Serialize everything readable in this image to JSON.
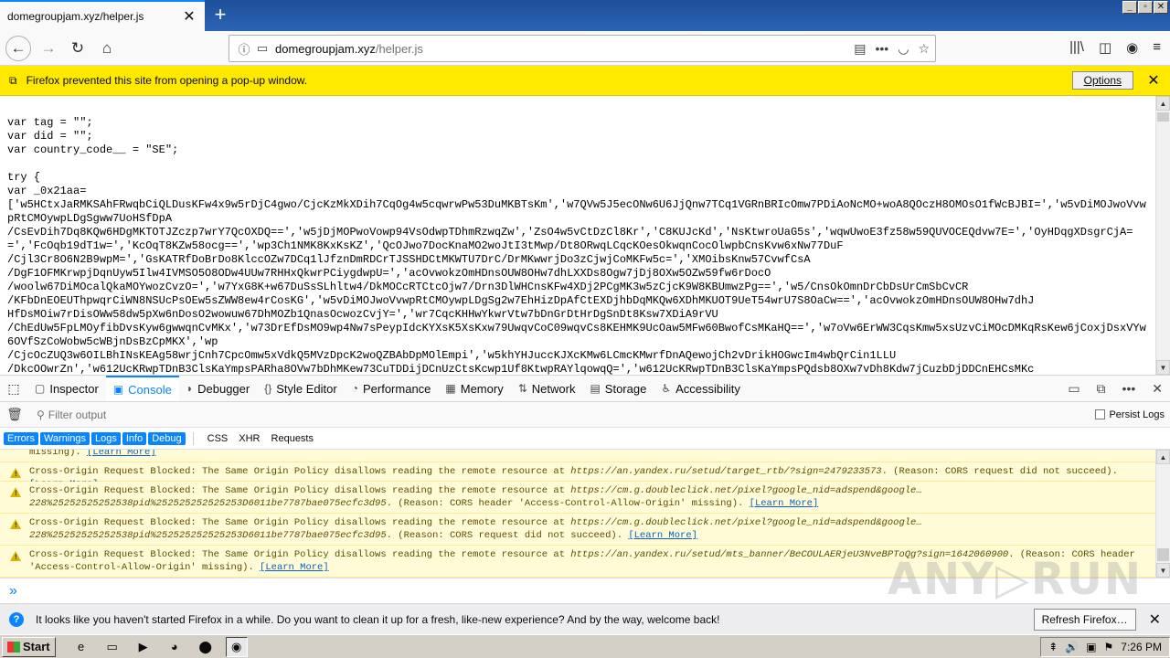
{
  "tab": {
    "title": "domegroupjam.xyz/helper.js",
    "close": "✕",
    "new_tab": "+"
  },
  "window_controls": [
    "_",
    "▫",
    "✕"
  ],
  "nav": {
    "back": "←",
    "forward": "→",
    "reload": "↻",
    "home": "⌂",
    "url_host": "domegroupjam.xyz",
    "url_path": "/helper.js",
    "info_icon": "ⓘ",
    "page_icon": "▭",
    "reader": "▤",
    "more": "•••",
    "pocket": "◡",
    "bookmark": "☆",
    "library": "|||\\",
    "sidebar": "◫",
    "account": "◉",
    "menu": "≡"
  },
  "popup_bar": {
    "icon": "⧉",
    "message": "Firefox prevented this site from opening a pop-up window.",
    "options": "Options",
    "close": "✕"
  },
  "code_text": "var tag = \"\";\nvar did = \"\";\nvar country_code__ = \"SE\";\n\ntry {\nvar _0x21aa=\n['w5HCtxJaRMKSAhFRwqbCiQLDusKFw4x9w5rDjC4gwo/CjcKzMkXDih7CqOg4w5cqwrwPw53DuMKBTsKm','w7QVw5J5ecONw6U6JjQnw7TCq1VGRnBRIcOmw7PDiAoNcMO+woA8QOczH8OMOsO1fWcBJBI=','w5vDiMOJwoVvwpRtCMOywpLDgSgww7UoHSfDpA\n/CsEvDih7Dq8KQw6HDgMKTOTJZczp7wrY7QcOXDQ==','w5jDjMOPwoVowp94VsOdwpTDhmRzwqZw','ZsO4w5vCtDzCl8Kr','C8KUJcKd','NsKtwroUaG5s','wqwUwoE3fz58w59QUVOCEQdvw7E=','OyHDqgXDsgrCjA==','FcOqb19dT1w=','KcOqT8KZw58ocg==','wp3Ch1NMK8KxKsKZ','QcOJwo7DocKnaMO2woJtI3tMwp/Dt8ORwqLCqcKOesOkwqnCocOlwpbCnsKvw6xNw77DuF\n/Cjl3Cr8O6N2B9wpM=','GsKATRfDoBrDo8KlccOZw7DCq1lJfznDmRDCrTJSSHDCtMKWTU7DrC/DrMKwwrjDo3zCjwjCoMKFw5c=','XMOibsKnw57CvwfCsA\n/DgF1OFMKrwpjDqnUyw5Ilw4IVMSO5O8ODw4UUw7RHHxQkwrPCiygdwpU=','acOvwokzOmHDnsOUW8OHw7dhLXXDs8Ogw7jDj8OXw5OZw59fw6rDocO\n/woolw67DiMOcalQkaMOYwozCvzO=','w7YxG8K+w67DuSsSLhltw4/DkMOCcRTCtcOjw7/Drn3DlWHCnsKFw4XDj2PCgMK3w5zCjcK9W8KBUmwzPg==','w5/CnsOkOmnDrCbDsUrCmSbCvCR\n/KFbDnEOEUThpwqrCiWN8NSUcPsOEw5sZWW8ew4rCosKG','w5vDiMOJwoVvwpRtCMOywpLDgSg2w7EhHizDpAfCtEXDjhbDqMKQw6XDhMKUOT9UeT54wrU7S8OaCw==','acOvwokzOmHDnsOUW8OHw7dhJ\nHfDsMOiw7rDisOWw58dw5pXw6nDosO2wowuw67DhMOZb1QnasOcwozCvjY=','wr7CqcKHHwYkwrVtw7bDnGrDtHrDgSnDt8Ksw7XDiA9rVU\n/ChEdUw5FpLMOyfibDvsKyw6gwwqnCvMKx','w73DrEfDsMO9wp4Nw7sPeypIdcKYXsK5XsKxw79UwqvCoC09wqvCs8KEHMK9UcOaw5MFw60BwofCsMKaHQ==','w7oVw6ErWW3CqsKmw5xsUzvCiMOcDMKqRsKew6jCoxjDsxVYw6OVfSzCoWobw5cWBjnDsBzCpMKX','wp\n/CjcOcZUQ3w6OILBhINsKEAg58wrjCnh7CpcOmw5xVdkQ5MVzDpcK2woQZBAbDpMOlEmpi','w5khYHJuccKJXcKMw6LCmcKMwrfDnAQewojCh2vDrikHOGwcIm4wbQrCin1LLU\n/DkcOOwrZn','w612UcKRwpTDnB3ClsKaYmpsPARha8OVw7bDhMKew73CuTDDijDCnUzCtsKcwp1Uf8KtwpRAYlqowqQ=','w612UcKRwpTDnB3ClsKaYmpsPQdsb8OXw7vDh8Kdw7jCuzbDjDDCnEHCsMKc",
  "devtools": {
    "pick_icon": "⬚",
    "tabs": [
      {
        "icon": "▢",
        "label": "Inspector"
      },
      {
        "icon": "▣",
        "label": "Console"
      },
      {
        "icon": "◗",
        "label": "Debugger"
      },
      {
        "icon": "{}",
        "label": "Style Editor"
      },
      {
        "icon": "◔",
        "label": "Performance"
      },
      {
        "icon": "▦",
        "label": "Memory"
      },
      {
        "icon": "⇅",
        "label": "Network"
      },
      {
        "icon": "▤",
        "label": "Storage"
      },
      {
        "icon": "♿",
        "label": "Accessibility"
      }
    ],
    "right_icons": [
      "▭",
      "⧉",
      "•••",
      "✕"
    ]
  },
  "filter": {
    "trash": "🗑",
    "icon": "⚲",
    "placeholder": "Filter output",
    "persist_logs": "Persist Logs"
  },
  "levels": [
    "Errors",
    "Warnings",
    "Logs",
    "Info",
    "Debug"
  ],
  "requests": [
    "CSS",
    "XHR",
    "Requests"
  ],
  "messages": [
    {
      "pre": "missing). ",
      "url": "",
      "post": "",
      "learn": "[Learn More]"
    },
    {
      "pre": "Cross-Origin Request Blocked: The Same Origin Policy disallows reading the remote resource at ",
      "url": "https://an.yandex.ru/setud/target_rtb/?sign=2479233573",
      "post": ". (Reason: CORS request did not succeed). ",
      "learn": "[Learn More]"
    },
    {
      "pre": "Cross-Origin Request Blocked: The Same Origin Policy disallows reading the remote resource at ",
      "url": "https://cm.g.doubleclick.net/pixel?google_nid=adspend&google…228%25252525252538pid%252525252525253D6011be7787bae075ecfc3d95",
      "post": ". (Reason: CORS header 'Access-Control-Allow-Origin' missing). ",
      "learn": "[Learn More]"
    },
    {
      "pre": "Cross-Origin Request Blocked: The Same Origin Policy disallows reading the remote resource at ",
      "url": "https://cm.g.doubleclick.net/pixel?google_nid=adspend&google…228%25252525252538pid%252525252525253D6011be7787bae075ecfc3d95",
      "post": ". (Reason: CORS request did not succeed). ",
      "learn": "[Learn More]"
    },
    {
      "pre": "Cross-Origin Request Blocked: The Same Origin Policy disallows reading the remote resource at ",
      "url": "https://an.yandex.ru/setud/mts_banner/BeCOULAERjeU3NveBPToQg?sign=1642060900",
      "post": ". (Reason: CORS header 'Access-Control-Allow-Origin' missing). ",
      "learn": "[Learn More]"
    }
  ],
  "console_prompt": "»",
  "watermark": "ANY▷RUN",
  "notification": {
    "icon": "?",
    "message": "It looks like you haven't started Firefox in a while. Do you want to clean it up for a fresh, like-new experience? And by the way, welcome back!",
    "button": "Refresh Firefox…",
    "close": "✕"
  },
  "taskbar": {
    "start": "Start",
    "apps": [
      "e",
      "▭",
      "▶",
      "◕",
      "⬤",
      "◉"
    ],
    "tray_icons": [
      "⇞",
      "🔊",
      "▣",
      "⚑"
    ],
    "clock": "7:26 PM"
  }
}
